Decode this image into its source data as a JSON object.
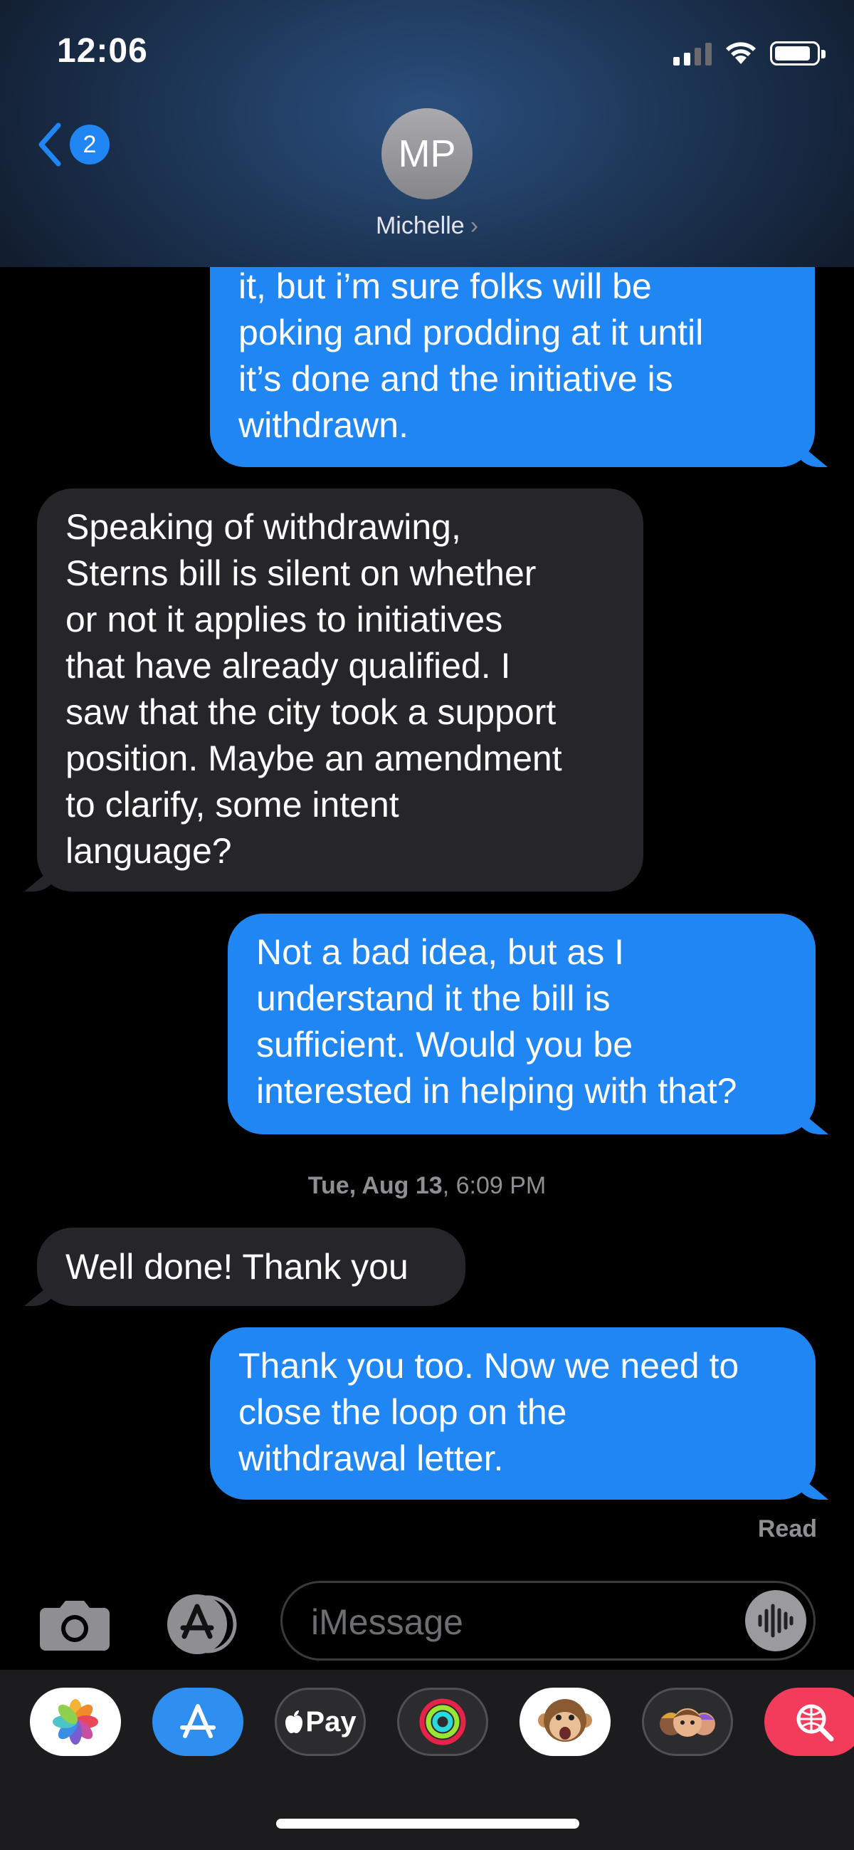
{
  "status_bar": {
    "time": "12:06"
  },
  "header": {
    "back_badge": "2",
    "avatar_initials": "MP",
    "contact_name": "Michelle",
    "contact_chevron": "›"
  },
  "messages": [
    {
      "direction": "outgoing",
      "text": "it, but i’m sure folks will be\npoking and prodding at it until\nit’s done and the initiative is\nwithdrawn."
    },
    {
      "direction": "incoming",
      "text": "Speaking of withdrawing,\nSterns bill is silent on whether\nor not it applies to initiatives\nthat have already qualified. I\nsaw that the city took a support\nposition. Maybe an amendment\nto clarify, some intent\nlanguage?"
    },
    {
      "direction": "outgoing",
      "text": "Not a bad idea, but as I\nunderstand it the bill is\nsufficient. Would you be\ninterested in helping with that?"
    },
    {
      "direction": "incoming",
      "text": "Well done! Thank you"
    },
    {
      "direction": "outgoing",
      "text": "Thank you too. Now we need to\nclose the loop on the\nwithdrawal letter."
    }
  ],
  "timestamp": {
    "day": "Tue, Aug 13",
    "time": ", 6:09 PM"
  },
  "read_receipt": "Read",
  "compose": {
    "placeholder": "iMessage"
  },
  "app_drawer": {
    "apps": [
      "photos-icon",
      "app-store-icon",
      "apple-pay-icon",
      "activity-icon",
      "animoji-icon",
      "memoji-icon",
      "web-images-icon"
    ],
    "apple_pay_label": "Pay"
  },
  "colors": {
    "outgoing": "#1f86f4",
    "incoming": "#26252a",
    "background": "#000000"
  }
}
